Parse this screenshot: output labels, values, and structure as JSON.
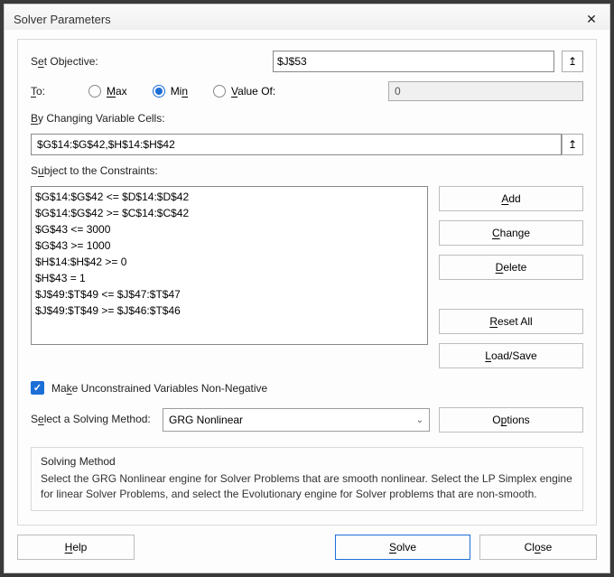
{
  "window": {
    "title": "Solver Parameters",
    "close_icon": "✕"
  },
  "objective": {
    "label_prefix": "S",
    "label_u": "e",
    "label_rest": "t Objective:",
    "value": "$J$53",
    "ref_icon": "↥"
  },
  "to": {
    "label_u": "T",
    "label_rest": "o:",
    "max_u": "M",
    "max_rest": "ax",
    "min_prefix": "Mi",
    "min_u": "n",
    "valueof_u": "V",
    "valueof_rest": "alue Of:",
    "value_input": "0",
    "selected": "min"
  },
  "changing": {
    "label_u": "B",
    "label_rest": "y Changing Variable Cells:",
    "value": "$G$14:$G$42,$H$14:$H$42",
    "ref_icon": "↥"
  },
  "constraints": {
    "label_prefix": "S",
    "label_u": "u",
    "label_rest": "bject to the Constraints:",
    "lines": [
      "$G$14:$G$42 <= $D$14:$D$42",
      "$G$14:$G$42 >= $C$14:$C$42",
      "$G$43 <= 3000",
      "$G$43 >= 1000",
      "$H$14:$H$42 >= 0",
      "$H$43 = 1",
      "$J$49:$T$49 <= $J$47:$T$47",
      "$J$49:$T$49 >= $J$46:$T$46"
    ]
  },
  "side": {
    "add_u": "A",
    "add_rest": "dd",
    "change_u": "C",
    "change_rest": "hange",
    "delete_u": "D",
    "delete_rest": "elete",
    "reset_u": "R",
    "reset_rest": "eset All",
    "load_u": "L",
    "load_rest": "oad/Save"
  },
  "uncon": {
    "label_prefix": "Ma",
    "label_u": "k",
    "label_rest": "e Unconstrained Variables Non-Negative",
    "checked": true,
    "check_icon": "✓"
  },
  "method": {
    "label_prefix": "S",
    "label_u": "e",
    "label_rest": "lect a Solving Method:",
    "value": "GRG Nonlinear",
    "chev_icon": "⌄",
    "options_prefix": "O",
    "options_u": "p",
    "options_rest": "tions"
  },
  "info": {
    "title": "Solving Method",
    "body": "Select the GRG Nonlinear engine for Solver Problems that are smooth nonlinear. Select the LP Simplex engine for linear Solver Problems, and select the Evolutionary engine for Solver problems that are non-smooth."
  },
  "footer": {
    "help_u": "H",
    "help_rest": "elp",
    "solve_u": "S",
    "solve_rest": "olve",
    "close_prefix": "Cl",
    "close_u": "o",
    "close_rest": "se"
  }
}
